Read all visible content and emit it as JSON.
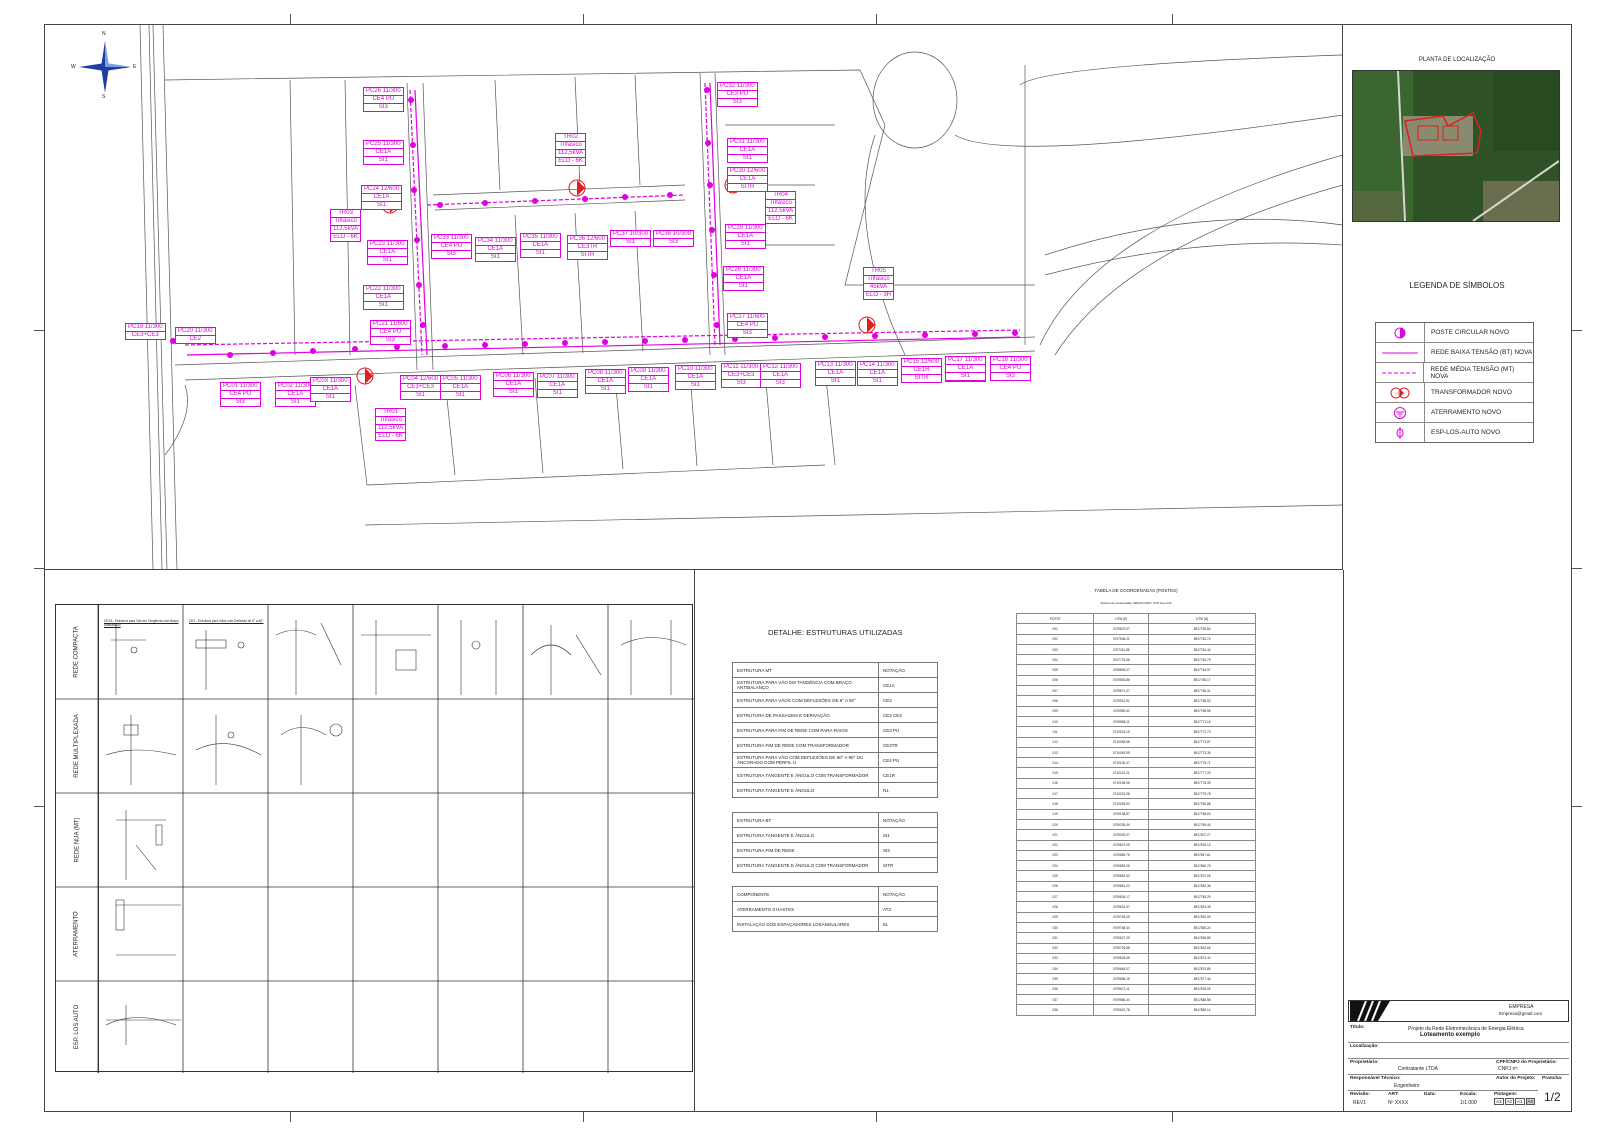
{
  "north": {
    "n": "N",
    "s": "S",
    "e": "E",
    "w": "W"
  },
  "location_plan": {
    "title": "PLANTA DE LOCALIZAÇÃO"
  },
  "legend": {
    "title": "LEGENDA DE SÍMBOLOS",
    "items": [
      {
        "label": "POSTE CIRCULAR NOVO",
        "icon": "pole-icon"
      },
      {
        "label": "REDE BAIXA TENSÃO (BT) NOVA",
        "icon": "line-icon"
      },
      {
        "label": "REDE MÉDIA TENSÃO (MT) NOVA",
        "icon": "dashed-line-icon"
      },
      {
        "label": "TRANSFORMADOR NOVO",
        "icon": "transformer-icon"
      },
      {
        "label": "ATERRAMENTO NOVO",
        "icon": "ground-icon"
      },
      {
        "label": "ESP-LOS-AUTO NOVO",
        "icon": "spacer-icon"
      }
    ],
    "colors": {
      "network": "#e000e0",
      "transformer": "#e02020"
    }
  },
  "poles": [
    {
      "l1": "PC26 11/300",
      "l2": "CE4 PU",
      "l3": "SI3"
    },
    {
      "l1": "PC25 11/300",
      "l2": "CE1A",
      "l3": "SI1"
    },
    {
      "l1": "PC24 12/600",
      "l2": "CE1A",
      "l3": "SI1"
    },
    {
      "l1": "PC23 11/300",
      "l2": "CE1A",
      "l3": "SI1"
    },
    {
      "l1": "PC22 11/300",
      "l2": "CE1A",
      "l3": "SI1"
    },
    {
      "l1": "PC21 11/600",
      "l2": "CE4 PU",
      "l3": "SI3"
    },
    {
      "l1": "PC33 11/300",
      "l2": "CE4 PU",
      "l3": "SI3"
    },
    {
      "l1": "PC34 11/300",
      "l2": "CE1A",
      "l3": "SI1"
    },
    {
      "l1": "PC35 11/300",
      "l2": "CE1A",
      "l3": "SI1"
    },
    {
      "l1": "PC36 12/600",
      "l2": "CE3TR",
      "l3": "SITR"
    },
    {
      "l1": "PC37 10/300",
      "l2": "SI1"
    },
    {
      "l1": "PC38 10/300",
      "l2": "SI3"
    },
    {
      "l1": "PC32 11/300",
      "l2": "CE3 PU",
      "l3": "SI3"
    },
    {
      "l1": "PC31 11/300",
      "l2": "CE1A",
      "l3": "SI1"
    },
    {
      "l1": "PC30 12/600",
      "l2": "CE1A",
      "l3": "SITR"
    },
    {
      "l1": "PC29 11/300",
      "l2": "CE1A",
      "l3": "SI1"
    },
    {
      "l1": "PC28 11/300",
      "l2": "CE1A",
      "l3": "SI1"
    },
    {
      "l1": "PC27 11/600",
      "l2": "CE4 PU",
      "l3": "SI3"
    },
    {
      "l1": "PC19 11/300",
      "l2": "CE3+CE3"
    },
    {
      "l1": "PC20 11/300",
      "l2": "CE2"
    },
    {
      "l1": "PC01 11/300",
      "l2": "CE4 PU",
      "l3": "SI3"
    },
    {
      "l1": "PC02 11/300",
      "l2": "CE1A",
      "l3": "SI1"
    },
    {
      "l1": "PC03 11/300",
      "l2": "CE1A",
      "l3": "SI1"
    },
    {
      "l1": "PC04 12/600",
      "l2": "CE3+CE3",
      "l3": "SI1"
    },
    {
      "l1": "PC05 11/300",
      "l2": "CE1A",
      "l3": "SI1"
    },
    {
      "l1": "PC06 11/300",
      "l2": "CE1A",
      "l3": "SI1"
    },
    {
      "l1": "PC07 11/300",
      "l2": "CE1A",
      "l3": "SI1"
    },
    {
      "l1": "PC08 11/300",
      "l2": "CE1A",
      "l3": "SI1"
    },
    {
      "l1": "PC09 11/300",
      "l2": "CE1A",
      "l3": "SI1"
    },
    {
      "l1": "PC10 11/300",
      "l2": "CE1A",
      "l3": "SI1"
    },
    {
      "l1": "PC11 11/300",
      "l2": "CE3+CE3",
      "l3": "SI3"
    },
    {
      "l1": "PC12 11/300",
      "l2": "CE1A",
      "l3": "SI3"
    },
    {
      "l1": "PC13 11/300",
      "l2": "CE1A",
      "l3": "SI1"
    },
    {
      "l1": "PC14 11/300",
      "l2": "CE1A",
      "l3": "SI1"
    },
    {
      "l1": "PC15 12/600",
      "l2": "CE1R",
      "l3": "SITR"
    },
    {
      "l1": "PC16 11/300",
      "l2": "CE1A",
      "l3": "SI1"
    },
    {
      "l1": "PC17 11/300",
      "l2": "CE1A",
      "l3": "SI1"
    },
    {
      "l1": "PC18 11/300",
      "l2": "CE4 PU",
      "l3": "SI3"
    }
  ],
  "transformers": [
    {
      "id": "TR01",
      "l2": "Trifásico",
      "l3": "112,5kVA",
      "l4": "ELO - 6K"
    },
    {
      "id": "TR02",
      "l2": "Trifásico",
      "l3": "112,5kVA",
      "l4": "ELO - 6K"
    },
    {
      "id": "TR03",
      "l2": "Trifásico",
      "l3": "112,5kVA",
      "l4": "ELO - 6K"
    },
    {
      "id": "TR04",
      "l2": "Trifásico",
      "l3": "112,5kVA",
      "l4": "ELO - 6K"
    },
    {
      "id": "TR05",
      "l2": "Trifásico",
      "l3": "45kVA",
      "l4": "ELO - 3H"
    }
  ],
  "details": {
    "rows": [
      "REDE COMPACTA",
      "REDE MULTIPLEXADA",
      "REDE NUA (MT)",
      "ATERRAMENTO",
      "ESP. LOS AUTO"
    ],
    "cap1": "CE1A - Estrutura para Vão em Tangência com Braço Antibalanço",
    "cap2": "CE2 - Estrutura para Vãos com Deflexão de 6° a 60°"
  },
  "structures": {
    "title": "DETALHE: ESTRUTURAS UTILIZADAS",
    "mt_header": [
      "ESTRUTURA MT",
      "NOTAÇÃO"
    ],
    "mt": [
      [
        "ESTRUTURA PARA VÃO EM TANGÊNCIA COM BRAÇO ANTIBALANÇO",
        "CE1A"
      ],
      [
        "ESTRUTURA PARA VÃOS COM DEFLEXÕES DE 6° A 60°",
        "CE2"
      ],
      [
        "ESTRUTURA DE PASSAGEM E DERIVAÇÃO",
        "CE3 CE3"
      ],
      [
        "ESTRUTURA PARA FIM DE REDE COM PARA-RAIOS",
        "CE3 PU"
      ],
      [
        "ESTRUTURA FIM DE REDE COM TRANSFORMADOR",
        "CE3TR"
      ],
      [
        "ESTRUTURA PARA VÃO COM DEFLEXÕES DE 60° A 90° OU ANCORADO COM PERFIL U",
        "CE4 PU"
      ],
      [
        "ESTRUTURA TANGENTE E ÂNGULO COM TRANSFORMADOR",
        "CE1R"
      ],
      [
        "ESTRUTURA TANGENTE E ÂNGULO",
        "N1"
      ]
    ],
    "bt_header": [
      "ESTRUTURA BT",
      "NOTAÇÃO"
    ],
    "bt": [
      [
        "ESTRUTURA TANGENTE E ÂNGULO",
        "SI1"
      ],
      [
        "ESTRUTURA FIM DE REDE",
        "SI3"
      ],
      [
        "ESTRUTURA TANGENTE E ÂNGULO COM TRANSFORMADOR",
        "SITR"
      ]
    ],
    "comp_header": [
      "COMPONENTE",
      "NOTAÇÃO"
    ],
    "comp": [
      [
        "ATERRAMENTO 3 HASTES",
        "AT3"
      ],
      [
        "INSTALAÇÃO DOS ESPAÇADORES LOSANGULARES",
        "EL"
      ]
    ]
  },
  "coordinates": {
    "title": "TABELA DE COORDENADAS (POSTES)",
    "subtitle": "Sistema de coordenadas: SIRGAS 2000 / UTM zone 22S",
    "header": [
      "POSTE",
      "UTM (E)",
      "UTM (N)"
    ],
    "rows": [
      [
        "001",
        "0709670,07",
        "8917750,84"
      ],
      [
        "002",
        "0707536,21",
        "8917762,74"
      ],
      [
        "003",
        "0707411,85",
        "8917781,44"
      ],
      [
        "004",
        "0707776,56",
        "8917762,79"
      ],
      [
        "005",
        "0708806,07",
        "8917764,57"
      ],
      [
        "006",
        "0709830,86",
        "8917765,17"
      ],
      [
        "007",
        "0709871,37",
        "8917766,31"
      ],
      [
        "008",
        "0709912,92",
        "8917768,02"
      ],
      [
        "009",
        "0709950,52",
        "8917769,58"
      ],
      [
        "010",
        "0709986,11",
        "8917771,15"
      ],
      [
        "011",
        "0710023,15",
        "8917772,73"
      ],
      [
        "012",
        "0710045,98",
        "8917773,87"
      ],
      [
        "013",
        "0710063,95",
        "8917775,35"
      ],
      [
        "014",
        "0710130,47",
        "8917775,71"
      ],
      [
        "015",
        "0710151,21",
        "8917777,20"
      ],
      [
        "016",
        "0710196,35",
        "8917778,35"
      ],
      [
        "017",
        "0710231,98",
        "8917779,78"
      ],
      [
        "018",
        "0710263,52",
        "8917780,88"
      ],
      [
        "019",
        "0709138,87",
        "8917768,63"
      ],
      [
        "020",
        "0709235,44",
        "8917769,44"
      ],
      [
        "021",
        "0709392,07",
        "8917807,27"
      ],
      [
        "022",
        "0709607,05",
        "8917833,13"
      ],
      [
        "023",
        "0709855,75",
        "8917847,61"
      ],
      [
        "024",
        "0709853,05",
        "8917860,76"
      ],
      [
        "025",
        "0709853,53",
        "8917872,05"
      ],
      [
        "026",
        "0709861,22",
        "8917882,36"
      ],
      [
        "027",
        "0709634,17",
        "8917785,29"
      ],
      [
        "028",
        "0709631,97",
        "8917824,35"
      ],
      [
        "029",
        "0709763,05",
        "8917832,59"
      ],
      [
        "030",
        "0709768,44",
        "8917850,24"
      ],
      [
        "031",
        "0709627,29",
        "8917836,85"
      ],
      [
        "032",
        "0709726,88",
        "8917843,65"
      ],
      [
        "033",
        "0709629,65",
        "8917874,34"
      ],
      [
        "034",
        "0709663,07",
        "8917875,85"
      ],
      [
        "035",
        "0709666,15",
        "8917877,46"
      ],
      [
        "036",
        "0709672,11",
        "8917878,05"
      ],
      [
        "037",
        "0709586,44",
        "8917885,58"
      ],
      [
        "038",
        "0709622,78",
        "8917882,14"
      ]
    ]
  },
  "title_block": {
    "company": "EMPRESA",
    "email": "Empresa@gmail.com",
    "title_label": "Título:",
    "title": "Projeto da Rede Eletromecânica de Energia Elétrica",
    "subtitle": "Loteamento exemplo",
    "location_label": "Localização:",
    "owner_label": "Proprietário:",
    "owner": "Contratante LTDA",
    "cpf_label": "CPF/CNPJ do Proprietário:",
    "cpf": "CNPJ nº:",
    "tech_label": "Responsável Técnico:",
    "tech": "Engenheiro",
    "author_label": "Autor do Projeto:",
    "sheet_label": "Prancha:",
    "rev_label": "Revisão:",
    "rev": "REV1",
    "art_label": "ART:",
    "art": "Nº XXXX",
    "date_label": "Data:",
    "scale_label": "Escala:",
    "scale": "1/1.000",
    "format_label": "Plotagem:",
    "formats": [
      "A3",
      "A2",
      "A1",
      "A0"
    ],
    "sheet": "1/2"
  }
}
